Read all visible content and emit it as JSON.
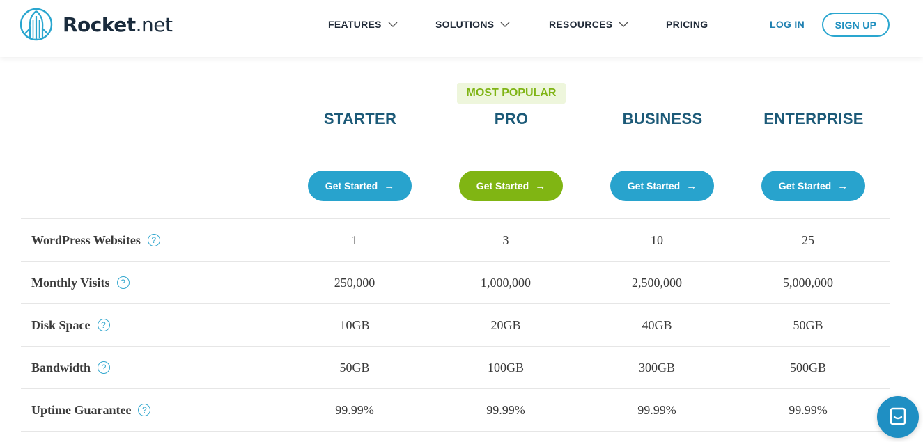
{
  "brand": {
    "name_bold": "Rocket",
    "name_light": ".net"
  },
  "nav": {
    "features": "FEATURES",
    "solutions": "SOLUTIONS",
    "resources": "RESOURCES",
    "pricing": "PRICING",
    "login": "LOG IN",
    "signup": "SIGN UP"
  },
  "badge": "MOST POPULAR",
  "plans": [
    {
      "name": "STARTER",
      "cta": "Get Started"
    },
    {
      "name": "PRO",
      "cta": "Get Started"
    },
    {
      "name": "BUSINESS",
      "cta": "Get Started"
    },
    {
      "name": "ENTERPRISE",
      "cta": "Get Started"
    }
  ],
  "cta_arrow": "→",
  "rows": [
    {
      "label": "WordPress Websites",
      "values": [
        "1",
        "3",
        "10",
        "25"
      ]
    },
    {
      "label": "Monthly Visits",
      "values": [
        "250,000",
        "1,000,000",
        "2,500,000",
        "5,000,000"
      ]
    },
    {
      "label": "Disk Space",
      "values": [
        "10GB",
        "20GB",
        "40GB",
        "50GB"
      ]
    },
    {
      "label": "Bandwidth",
      "values": [
        "50GB",
        "100GB",
        "300GB",
        "500GB"
      ]
    },
    {
      "label": "Uptime Guarantee",
      "values": [
        "99.99%",
        "99.99%",
        "99.99%",
        "99.99%"
      ]
    }
  ],
  "help_glyph": "?",
  "colors": {
    "accent_blue": "#28a3cd",
    "accent_green": "#80b513",
    "plan_title": "#1c5a78",
    "link_blue": "#1e7fb0"
  },
  "icons": {
    "logo": "rocket-logo-icon",
    "chevron": "chevron-down-icon",
    "arrow": "arrow-right-icon",
    "help": "question-circle-icon",
    "chat": "chat-bubble-icon"
  }
}
